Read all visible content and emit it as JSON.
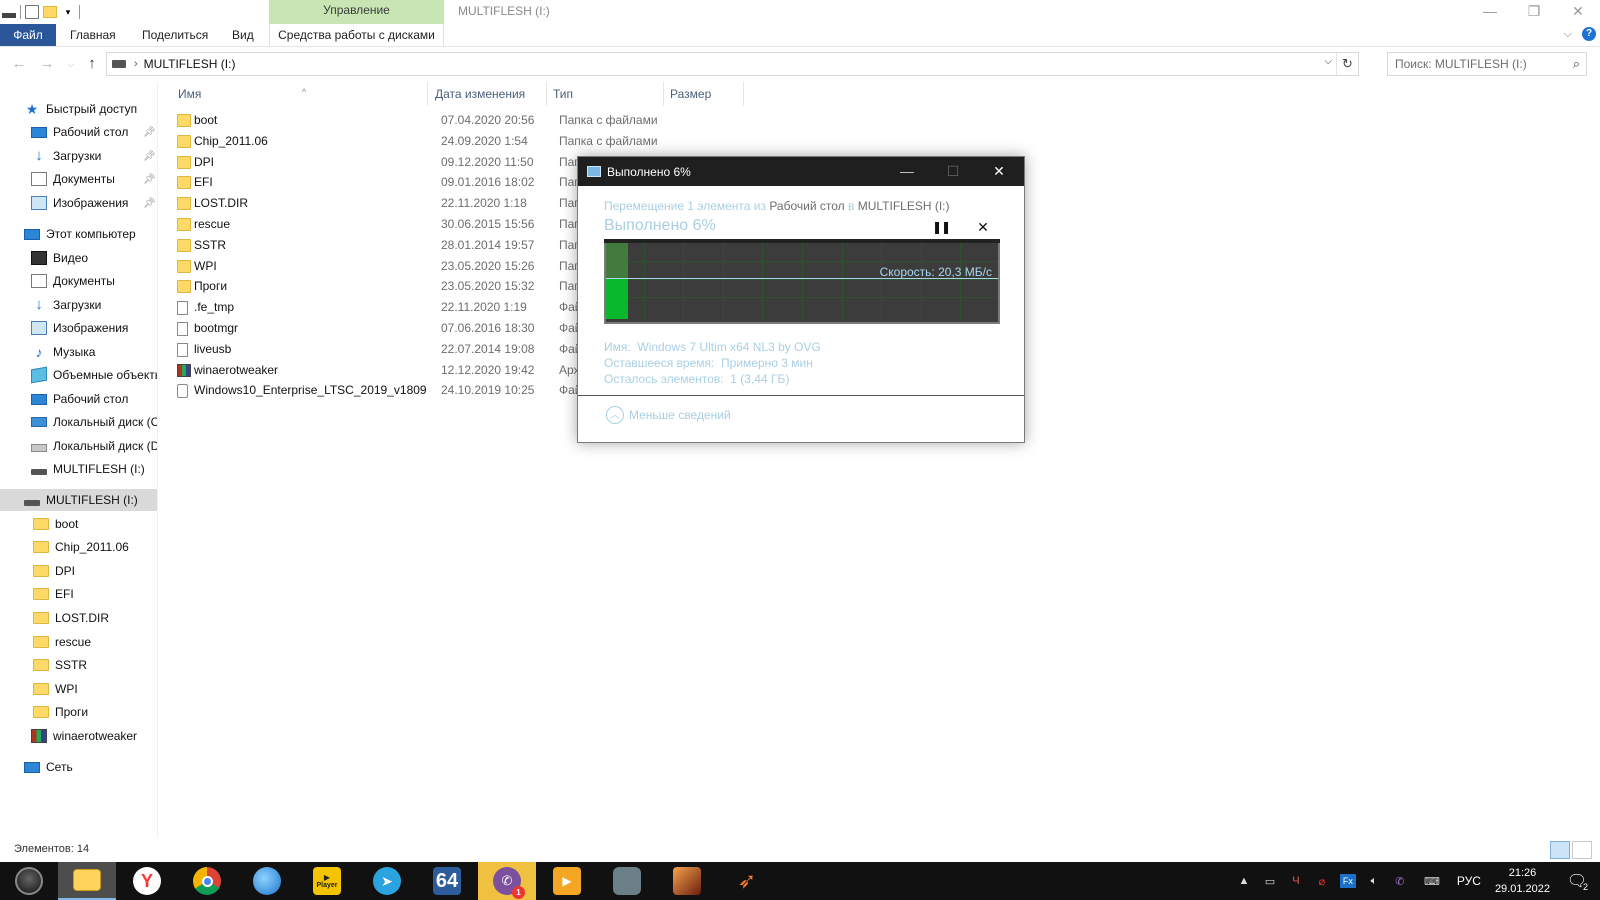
{
  "window": {
    "title": "MULTIFLESH (I:)",
    "context_tab_group": "Управление"
  },
  "ribbon": {
    "tabs": [
      "Файл",
      "Главная",
      "Поделиться",
      "Вид",
      "Средства работы с дисками"
    ]
  },
  "address": {
    "path": "MULTIFLESH (I:)",
    "search_placeholder": "Поиск: MULTIFLESH (I:)"
  },
  "nav_pane": {
    "quick_access": {
      "label": "Быстрый доступ",
      "items": [
        "Рабочий стол",
        "Загрузки",
        "Документы",
        "Изображения"
      ]
    },
    "this_pc": {
      "label": "Этот компьютер",
      "items": [
        "Видео",
        "Документы",
        "Загрузки",
        "Изображения",
        "Музыка",
        "Объемные объекты",
        "Рабочий стол",
        "Локальный диск (C:)",
        "Локальный диск (D:)",
        "MULTIFLESH (I:)"
      ]
    },
    "drive": {
      "label": "MULTIFLESH (I:)",
      "items": [
        "boot",
        "Chip_2011.06",
        "DPI",
        "EFI",
        "LOST.DIR",
        "rescue",
        "SSTR",
        "WPI",
        "Проги",
        "winaerotweaker"
      ]
    },
    "network": "Сеть"
  },
  "file_list": {
    "columns": [
      "Имя",
      "Дата изменения",
      "Тип",
      "Размер"
    ],
    "rows": [
      {
        "name": "boot",
        "date": "07.04.2020 20:56",
        "type": "Папка с файлами",
        "icon": "folder"
      },
      {
        "name": "Chip_2011.06",
        "date": "24.09.2020 1:54",
        "type": "Папка с файлами",
        "icon": "folder"
      },
      {
        "name": "DPI",
        "date": "09.12.2020 11:50",
        "type": "Пап",
        "icon": "folder"
      },
      {
        "name": "EFI",
        "date": "09.01.2016 18:02",
        "type": "Пап",
        "icon": "folder"
      },
      {
        "name": "LOST.DIR",
        "date": "22.11.2020 1:18",
        "type": "Пап",
        "icon": "folder"
      },
      {
        "name": "rescue",
        "date": "30.06.2015 15:56",
        "type": "Пап",
        "icon": "folder"
      },
      {
        "name": "SSTR",
        "date": "28.01.2014 19:57",
        "type": "Пап",
        "icon": "folder"
      },
      {
        "name": "WPI",
        "date": "23.05.2020 15:26",
        "type": "Пап",
        "icon": "folder"
      },
      {
        "name": "Проги",
        "date": "23.05.2020 15:32",
        "type": "Пап",
        "icon": "folder"
      },
      {
        "name": ".fe_tmp",
        "date": "22.11.2020 1:19",
        "type": "Фай",
        "icon": "file"
      },
      {
        "name": "bootmgr",
        "date": "07.06.2016 18:30",
        "type": "Фай",
        "icon": "file"
      },
      {
        "name": "liveusb",
        "date": "22.07.2014 19:08",
        "type": "Фай",
        "icon": "file"
      },
      {
        "name": "winaerotweaker",
        "date": "12.12.2020 19:42",
        "type": "Арх",
        "icon": "rar"
      },
      {
        "name": "Windows10_Enterprise_LTSC_2019_v1809...",
        "date": "24.10.2019 10:25",
        "type": "Фай",
        "icon": "iso"
      }
    ]
  },
  "status_bar": {
    "item_count": "Элементов: 14"
  },
  "progress_dialog": {
    "title": "Выполнено 6%",
    "desc_prefix": "Перемещение 1 элемента из ",
    "desc_source": "Рабочий стол",
    "desc_middle": " в ",
    "desc_dest": "MULTIFLESH (I:)",
    "percent_text": "Выполнено 6%",
    "progress": 0.06,
    "speed": "Скорость: 20,3 МБ/с",
    "details": {
      "name_label": "Имя:",
      "name_value": "Windows 7 Ultim x64 NL3 by OVG",
      "time_label": "Оставшееся время:",
      "time_value": "Примерно 3 мин",
      "items_label": "Осталось элементов:",
      "items_value": "1 (3,44 ГБ)"
    },
    "less_details": "Меньше сведений"
  },
  "taskbar": {
    "apps": [
      {
        "name": "start-button",
        "label": ""
      },
      {
        "name": "file-explorer",
        "label": ""
      },
      {
        "name": "yandex-browser",
        "label": "Y"
      },
      {
        "name": "chrome",
        "label": ""
      },
      {
        "name": "browser-globe",
        "label": ""
      },
      {
        "name": "player",
        "label": "Player"
      },
      {
        "name": "telegram",
        "label": ""
      },
      {
        "name": "aida64",
        "label": "64"
      },
      {
        "name": "viber",
        "label": ""
      },
      {
        "name": "media-player",
        "label": ""
      },
      {
        "name": "game-robot",
        "label": ""
      },
      {
        "name": "game-warrior",
        "label": ""
      },
      {
        "name": "app-arrow",
        "label": ""
      }
    ],
    "lang": "РУС",
    "time": "21:26",
    "date": "29.01.2022",
    "notif_count": "2",
    "viber_badge": "1"
  }
}
